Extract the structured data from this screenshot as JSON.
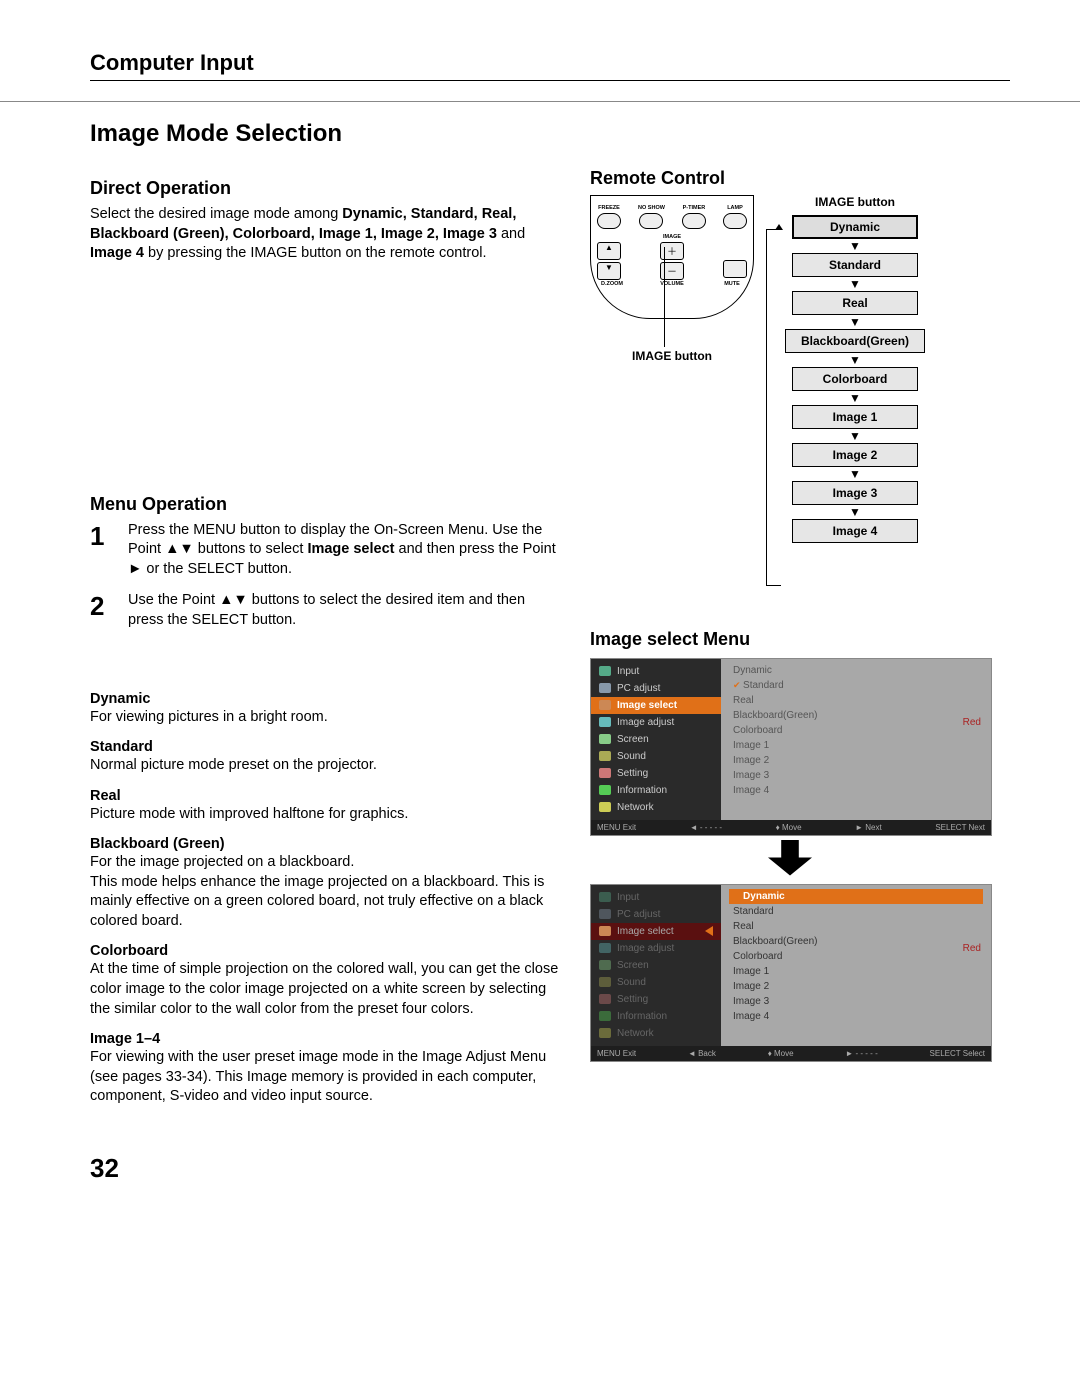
{
  "section": "Computer Input",
  "title": "Image Mode Selection",
  "direct": {
    "heading": "Direct Operation",
    "text_pre": "Select the desired image mode among ",
    "bold_list": "Dynamic, Standard, Real, Blackboard (Green), Colorboard, Image 1, Image 2, Image 3",
    "text_mid": " and ",
    "bold_last": "Image 4",
    "text_post": " by pressing the IMAGE button on the remote control."
  },
  "remote": {
    "heading": "Remote Control",
    "callout": "IMAGE button",
    "top_labels": [
      "FREEZE",
      "NO SHOW",
      "P-TIMER",
      "LAMP"
    ],
    "mid_label": "IMAGE",
    "bot_labels": [
      "D.ZOOM",
      "VOLUME",
      "MUTE"
    ]
  },
  "cycle": {
    "title": "IMAGE button",
    "items": [
      "Dynamic",
      "Standard",
      "Real",
      "Blackboard(Green)",
      "Colorboard",
      "Image 1",
      "Image 2",
      "Image 3",
      "Image 4"
    ]
  },
  "menu_op": {
    "heading": "Menu Operation",
    "steps": [
      "Press the MENU button to display the On-Screen Menu. Use the Point ▲▼ buttons to select Image select and then press the Point ► or the SELECT button.",
      "Use the Point ▲▼ buttons to select  the desired item and then press the SELECT button."
    ],
    "step_nums": [
      "1",
      "2"
    ]
  },
  "defs": [
    {
      "t": "Dynamic",
      "d": "For viewing pictures in a bright room."
    },
    {
      "t": "Standard",
      "d": "Normal picture mode preset on the projector."
    },
    {
      "t": "Real",
      "d": "Picture mode with improved halftone for graphics."
    },
    {
      "t": "Blackboard (Green)",
      "d": "For the image projected on a blackboard.\nThis mode helps enhance the image projected on a blackboard. This is mainly effective on a green colored board, not truly effective on a black colored board."
    },
    {
      "t": "Colorboard",
      "d": "At the time of simple projection on the colored wall, you can get the close color image to the color image projected on a white screen by selecting the similar color to the wall color from the preset four colors."
    },
    {
      "t": "Image 1–4",
      "d": "For viewing with the user preset image mode in the Image Adjust Menu (see pages 33-34). This Image memory is provided in each computer, component, S-video and video input source."
    }
  ],
  "menu_ss": {
    "heading": "Image select Menu",
    "left_items": [
      "Input",
      "PC adjust",
      "Image select",
      "Image adjust",
      "Screen",
      "Sound",
      "Setting",
      "Information",
      "Network"
    ],
    "right_items": [
      "Dynamic",
      "Standard",
      "Real",
      "Blackboard(Green)",
      "Colorboard",
      "Image 1",
      "Image 2",
      "Image 3",
      "Image 4"
    ],
    "red_label": "Red",
    "footer1": [
      "MENU Exit",
      "◄ - - - - -",
      "♦ Move",
      "► Next",
      "SELECT Next"
    ],
    "footer2": [
      "MENU Exit",
      "◄ Back",
      "♦ Move",
      "► - - - - -",
      "SELECT Select"
    ]
  },
  "page_number": "32"
}
